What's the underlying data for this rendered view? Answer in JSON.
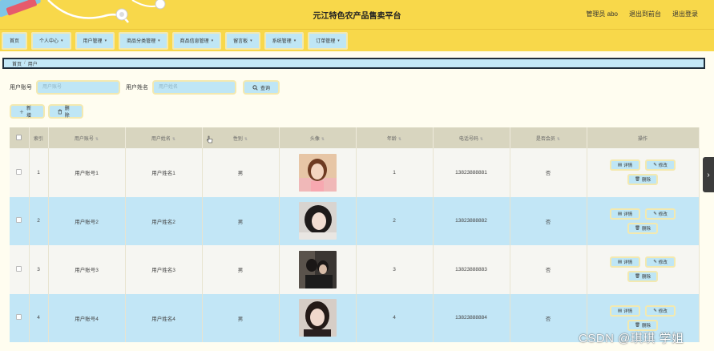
{
  "header": {
    "title": "元江特色农产品售卖平台",
    "admin_label": "管理员 abo",
    "back_label": "退出到前台",
    "logout_label": "退出登录"
  },
  "nav": [
    {
      "label": "首页",
      "has_caret": false
    },
    {
      "label": "个人中心",
      "has_caret": true
    },
    {
      "label": "用户管理",
      "has_caret": true
    },
    {
      "label": "商品分类管理",
      "has_caret": true
    },
    {
      "label": "商品信息管理",
      "has_caret": true
    },
    {
      "label": "留言板",
      "has_caret": true
    },
    {
      "label": "系统管理",
      "has_caret": true
    },
    {
      "label": "订单管理",
      "has_caret": true
    }
  ],
  "breadcrumb": {
    "home": "首页",
    "sep": "/",
    "current": "用户"
  },
  "search": {
    "account_label": "用户账号",
    "account_placeholder": "用户账号",
    "name_label": "用户姓名",
    "name_placeholder": "用户姓名",
    "query_label": "查询"
  },
  "actions": {
    "add_label": "新增",
    "delete_label": "删除"
  },
  "table": {
    "headers": [
      "索引",
      "用户账号",
      "用户姓名",
      "性别",
      "头像",
      "年龄",
      "电话号码",
      "是否会员",
      "操作"
    ],
    "rows": [
      {
        "index": "1",
        "account": "用户账号1",
        "name": "用户姓名1",
        "gender": "男",
        "age": "1",
        "phone": "13823888881",
        "member": "否"
      },
      {
        "index": "2",
        "account": "用户账号2",
        "name": "用户姓名2",
        "gender": "男",
        "age": "2",
        "phone": "13823888882",
        "member": "否"
      },
      {
        "index": "3",
        "account": "用户账号3",
        "name": "用户姓名3",
        "gender": "男",
        "age": "3",
        "phone": "13823888883",
        "member": "否"
      },
      {
        "index": "4",
        "account": "用户账号4",
        "name": "用户姓名4",
        "gender": "男",
        "age": "4",
        "phone": "13823888884",
        "member": "否"
      }
    ],
    "op_labels": {
      "detail": "详情",
      "edit": "修改",
      "delete": "删除"
    }
  },
  "watermark": "CSDN @琪琪 学姐",
  "colors": {
    "header_bg": "#f8d84a",
    "button_bg": "#bfe6f5",
    "button_border": "#f3e9b0",
    "row_even": "#c2e6f6",
    "table_head": "#d8d5bf"
  }
}
